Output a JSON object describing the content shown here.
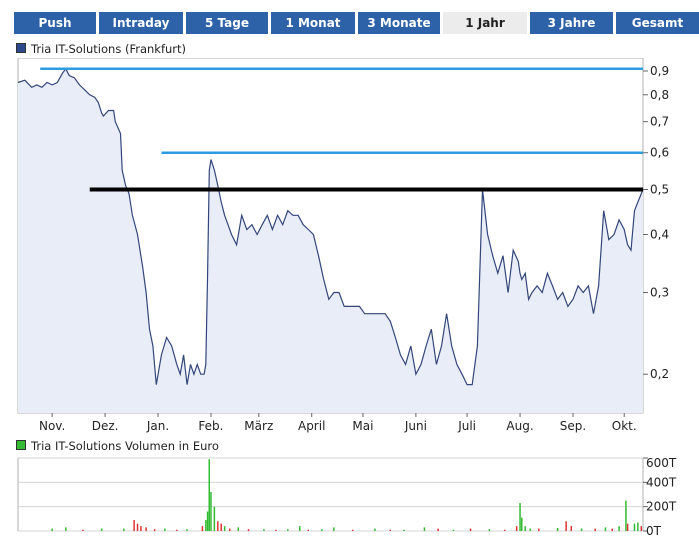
{
  "tabs": [
    {
      "label": "Push",
      "active": false
    },
    {
      "label": "Intraday",
      "active": false
    },
    {
      "label": "5 Tage",
      "active": false
    },
    {
      "label": "1 Monat",
      "active": false
    },
    {
      "label": "3 Monate",
      "active": false
    },
    {
      "label": "1 Jahr",
      "active": true
    },
    {
      "label": "3 Jahre",
      "active": false
    },
    {
      "label": "Gesamt",
      "active": false
    }
  ],
  "colors": {
    "tab_bg": "#2e62a8",
    "tab_active_bg": "#ececec",
    "price_line": "#33467a",
    "price_fill": "#e8edf8",
    "resistance_line": "#2c9be0",
    "support_line": "#000000",
    "volume_up": "#33bb33",
    "volume_down": "#dd3333"
  },
  "chart_data": [
    {
      "type": "line",
      "legend": "Tria IT-Solutions (Frankfurt)",
      "legend_color": "#2a4a8a",
      "scale": "log",
      "ylim": [
        0.165,
        0.96
      ],
      "y_ticks": [
        "0,9",
        "0,8",
        "0,7",
        "0,6",
        "0,5",
        "0,4",
        "0,3",
        "0,2"
      ],
      "y_tick_values": [
        0.9,
        0.8,
        0.7,
        0.6,
        0.5,
        0.4,
        0.3,
        0.2
      ],
      "x_ticks": [
        "Nov.",
        "Dez.",
        "Jan.",
        "Feb.",
        "März",
        "April",
        "Mai",
        "Juni",
        "Juli",
        "Aug.",
        "Sep.",
        "Okt."
      ],
      "x_tick_days": [
        20,
        51,
        82,
        113,
        141,
        172,
        202,
        233,
        263,
        294,
        325,
        355
      ],
      "x_range_days": [
        0,
        366
      ],
      "grid": false,
      "series": [
        {
          "day": [
            0,
            4,
            8,
            11,
            14,
            17,
            20,
            23,
            26,
            28,
            30,
            33,
            36,
            39,
            42,
            45,
            47,
            49,
            50,
            53,
            56,
            57,
            60,
            61,
            63,
            65,
            67,
            70,
            73,
            75,
            77,
            79,
            81,
            84,
            87,
            90,
            93,
            95,
            97,
            99,
            101,
            103,
            105,
            107,
            109,
            110,
            111,
            112,
            113,
            115,
            117,
            119,
            121,
            123,
            125,
            128,
            131,
            134,
            137,
            140,
            143,
            146,
            149,
            152,
            155,
            158,
            161,
            164,
            167,
            170,
            173,
            176,
            179,
            182,
            185,
            188,
            191,
            194,
            197,
            200,
            203,
            206,
            209,
            212,
            215,
            218,
            221,
            224,
            227,
            230,
            233,
            236,
            239,
            242,
            245,
            248,
            251,
            254,
            257,
            260,
            263,
            266,
            269,
            272,
            275,
            278,
            281,
            284,
            287,
            290,
            293,
            294,
            295,
            297,
            299,
            301,
            304,
            307,
            310,
            313,
            316,
            319,
            322,
            325,
            328,
            331,
            334,
            337,
            340,
            343,
            346,
            349,
            352,
            355,
            357,
            359,
            361,
            363,
            366
          ],
          "value": [
            0.85,
            0.86,
            0.83,
            0.84,
            0.83,
            0.85,
            0.84,
            0.85,
            0.89,
            0.91,
            0.88,
            0.87,
            0.84,
            0.82,
            0.8,
            0.79,
            0.77,
            0.73,
            0.72,
            0.74,
            0.74,
            0.7,
            0.66,
            0.55,
            0.51,
            0.49,
            0.44,
            0.4,
            0.34,
            0.3,
            0.25,
            0.23,
            0.19,
            0.22,
            0.24,
            0.23,
            0.21,
            0.2,
            0.22,
            0.19,
            0.21,
            0.2,
            0.21,
            0.2,
            0.2,
            0.21,
            0.32,
            0.55,
            0.58,
            0.55,
            0.51,
            0.47,
            0.44,
            0.42,
            0.4,
            0.38,
            0.44,
            0.41,
            0.42,
            0.4,
            0.42,
            0.44,
            0.41,
            0.44,
            0.42,
            0.45,
            0.44,
            0.44,
            0.42,
            0.41,
            0.4,
            0.36,
            0.32,
            0.29,
            0.3,
            0.3,
            0.28,
            0.28,
            0.28,
            0.28,
            0.27,
            0.27,
            0.27,
            0.27,
            0.27,
            0.26,
            0.24,
            0.22,
            0.21,
            0.23,
            0.2,
            0.21,
            0.23,
            0.25,
            0.21,
            0.23,
            0.27,
            0.23,
            0.21,
            0.2,
            0.19,
            0.19,
            0.23,
            0.5,
            0.4,
            0.36,
            0.33,
            0.36,
            0.3,
            0.37,
            0.35,
            0.33,
            0.32,
            0.33,
            0.29,
            0.3,
            0.31,
            0.3,
            0.33,
            0.31,
            0.29,
            0.3,
            0.28,
            0.29,
            0.31,
            0.3,
            0.31,
            0.27,
            0.31,
            0.45,
            0.39,
            0.4,
            0.43,
            0.41,
            0.38,
            0.37,
            0.45,
            0.47,
            0.5
          ]
        }
      ],
      "reference_lines": [
        {
          "value": 0.91,
          "from_day": 13,
          "style": "resistance"
        },
        {
          "value": 0.6,
          "from_day": 84,
          "style": "resistance"
        },
        {
          "value": 0.5,
          "from_day": 42,
          "style": "support"
        }
      ]
    },
    {
      "type": "bar",
      "legend": "Tria IT-Solutions Volumen in Euro",
      "legend_color": "#33bb33",
      "ylim": [
        0,
        600
      ],
      "y_ticks": [
        "600T",
        "400T",
        "200T",
        "0T"
      ],
      "y_tick_values": [
        600,
        400,
        200,
        0
      ],
      "x_range_days": [
        0,
        366
      ],
      "grid": true,
      "bars": [
        {
          "day": 20,
          "value": 20,
          "dir": "up"
        },
        {
          "day": 28,
          "value": 30,
          "dir": "up"
        },
        {
          "day": 38,
          "value": 10,
          "dir": "down"
        },
        {
          "day": 49,
          "value": 20,
          "dir": "up"
        },
        {
          "day": 62,
          "value": 20,
          "dir": "up"
        },
        {
          "day": 68,
          "value": 90,
          "dir": "down"
        },
        {
          "day": 70,
          "value": 60,
          "dir": "down"
        },
        {
          "day": 72,
          "value": 40,
          "dir": "down"
        },
        {
          "day": 75,
          "value": 30,
          "dir": "down"
        },
        {
          "day": 80,
          "value": 15,
          "dir": "down"
        },
        {
          "day": 86,
          "value": 20,
          "dir": "up"
        },
        {
          "day": 93,
          "value": 10,
          "dir": "down"
        },
        {
          "day": 99,
          "value": 15,
          "dir": "up"
        },
        {
          "day": 108,
          "value": 40,
          "dir": "down"
        },
        {
          "day": 110,
          "value": 90,
          "dir": "up"
        },
        {
          "day": 111,
          "value": 160,
          "dir": "up"
        },
        {
          "day": 112,
          "value": 590,
          "dir": "up"
        },
        {
          "day": 113,
          "value": 320,
          "dir": "up"
        },
        {
          "day": 115,
          "value": 200,
          "dir": "up"
        },
        {
          "day": 117,
          "value": 80,
          "dir": "down"
        },
        {
          "day": 119,
          "value": 60,
          "dir": "down"
        },
        {
          "day": 121,
          "value": 40,
          "dir": "up"
        },
        {
          "day": 124,
          "value": 20,
          "dir": "down"
        },
        {
          "day": 129,
          "value": 30,
          "dir": "up"
        },
        {
          "day": 135,
          "value": 15,
          "dir": "down"
        },
        {
          "day": 144,
          "value": 15,
          "dir": "up"
        },
        {
          "day": 151,
          "value": 10,
          "dir": "down"
        },
        {
          "day": 158,
          "value": 15,
          "dir": "up"
        },
        {
          "day": 165,
          "value": 40,
          "dir": "up"
        },
        {
          "day": 170,
          "value": 10,
          "dir": "down"
        },
        {
          "day": 178,
          "value": 15,
          "dir": "up"
        },
        {
          "day": 185,
          "value": 30,
          "dir": "up"
        },
        {
          "day": 196,
          "value": 10,
          "dir": "down"
        },
        {
          "day": 209,
          "value": 20,
          "dir": "up"
        },
        {
          "day": 218,
          "value": 10,
          "dir": "down"
        },
        {
          "day": 226,
          "value": 10,
          "dir": "up"
        },
        {
          "day": 238,
          "value": 30,
          "dir": "up"
        },
        {
          "day": 246,
          "value": 20,
          "dir": "down"
        },
        {
          "day": 255,
          "value": 10,
          "dir": "up"
        },
        {
          "day": 265,
          "value": 20,
          "dir": "down"
        },
        {
          "day": 276,
          "value": 15,
          "dir": "up"
        },
        {
          "day": 285,
          "value": 10,
          "dir": "down"
        },
        {
          "day": 292,
          "value": 40,
          "dir": "down"
        },
        {
          "day": 294,
          "value": 230,
          "dir": "up"
        },
        {
          "day": 295,
          "value": 110,
          "dir": "up"
        },
        {
          "day": 297,
          "value": 40,
          "dir": "up"
        },
        {
          "day": 300,
          "value": 20,
          "dir": "up"
        },
        {
          "day": 305,
          "value": 20,
          "dir": "down"
        },
        {
          "day": 316,
          "value": 25,
          "dir": "up"
        },
        {
          "day": 321,
          "value": 80,
          "dir": "down"
        },
        {
          "day": 324,
          "value": 40,
          "dir": "down"
        },
        {
          "day": 330,
          "value": 20,
          "dir": "up"
        },
        {
          "day": 338,
          "value": 20,
          "dir": "down"
        },
        {
          "day": 344,
          "value": 30,
          "dir": "up"
        },
        {
          "day": 348,
          "value": 20,
          "dir": "down"
        },
        {
          "day": 352,
          "value": 40,
          "dir": "up"
        },
        {
          "day": 356,
          "value": 250,
          "dir": "up"
        },
        {
          "day": 357,
          "value": 60,
          "dir": "down"
        },
        {
          "day": 361,
          "value": 60,
          "dir": "up"
        },
        {
          "day": 363,
          "value": 70,
          "dir": "up"
        },
        {
          "day": 365,
          "value": 40,
          "dir": "down"
        }
      ]
    }
  ]
}
